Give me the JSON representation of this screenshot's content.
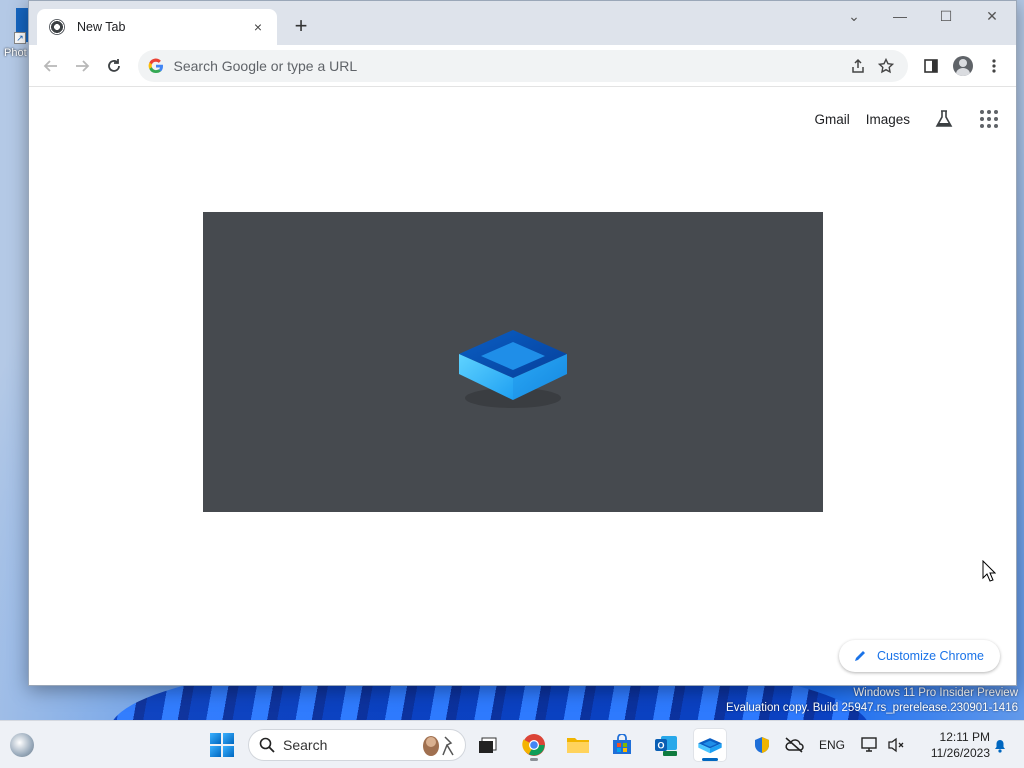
{
  "desktop": {
    "icon_label": "Phot - S",
    "watermark": {
      "line1": "Windows 11 Pro Insider Preview",
      "line2": "Evaluation copy. Build 25947.rs_prerelease.230901-1416"
    }
  },
  "browser": {
    "tab": {
      "title": "New Tab",
      "close": "×"
    },
    "new_tab": "+",
    "window_controls": {
      "tab_search": "⌄",
      "minimize": "—",
      "maximize": "☐",
      "close": "✕"
    },
    "omnibox": {
      "placeholder": "Search Google or type a URL",
      "value": ""
    },
    "new_tab_page": {
      "links": {
        "gmail": "Gmail",
        "images": "Images"
      },
      "customize_button": "Customize Chrome"
    }
  },
  "taskbar": {
    "search_label": "Search",
    "tray": {
      "language": "ENG"
    },
    "clock": {
      "time": "12:11 PM",
      "date": "11/26/2023"
    }
  },
  "colors": {
    "accent": "#1a73e8",
    "hero_bg": "#464a4f",
    "taskbar": "#eef1f6"
  }
}
